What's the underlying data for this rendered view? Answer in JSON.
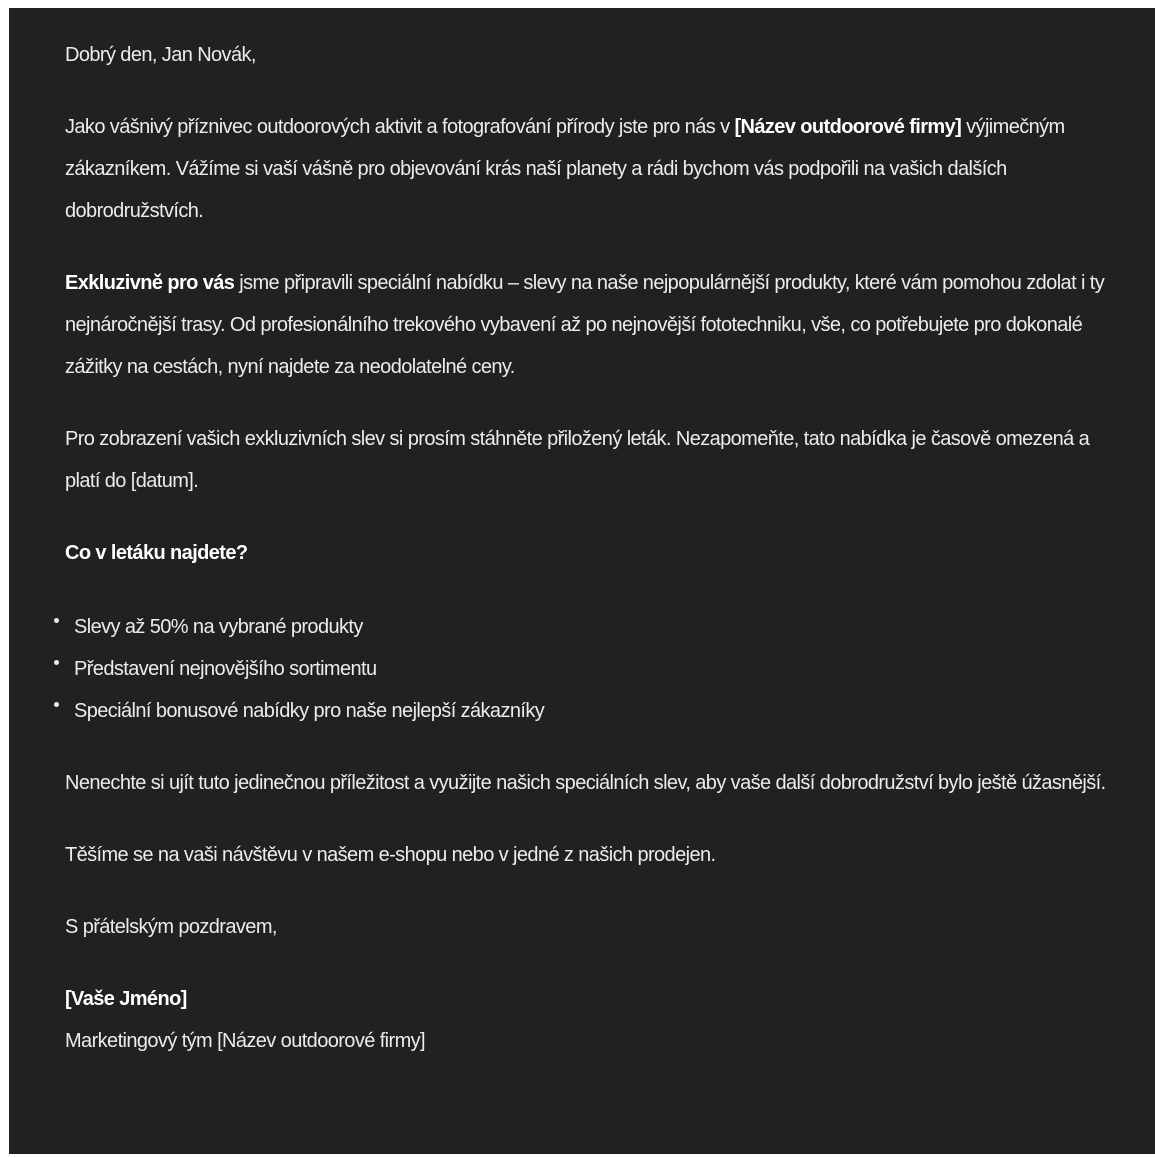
{
  "email": {
    "greeting": "Dobrý den, Jan Novák,",
    "intro": {
      "before": "Jako vášnivý příznivec outdoorových aktivit a fotografování přírody jste pro nás v ",
      "company": "[Název outdoorové firmy]",
      "after": " výjimečným zákazníkem. Vážíme si vaší vášně pro objevování krás naší planety a rádi bychom vás podpořili na vašich dalších dobrodružstvích."
    },
    "offer": {
      "lead": "Exkluzivně pro vás",
      "text": " jsme připravili speciální nabídku – slevy na naše nejpopulárnější produkty, které vám pomohou zdolat i ty nejnáročnější trasy. Od profesionálního trekového vybavení až po nejnovější fototechniku, vše, co potřebujete pro dokonalé zážitky na cestách, nyní najdete za neodolatelné ceny."
    },
    "download": "Pro zobrazení vašich exkluzivních slev si prosím stáhněte přiložený leták. Nezapomeňte, tato nabídka je časově omezená a platí do [datum].",
    "list_heading": "Co v letáku najdete?",
    "list_items": [
      "Slevy až 50% na vybrané produkty",
      "Představení nejnovějšího sortimentu",
      "Speciální bonusové nabídky pro naše nejlepší zákazníky"
    ],
    "cta": "Nenechte si ujít tuto jedinečnou příležitost a využijte našich speciálních slev, aby vaše další dobrodružství bylo ještě úžasnější.",
    "closing_line": "Těšíme se na vaši návštěvu v našem e-shopu nebo v jedné z našich prodejen.",
    "sign_off": "S přátelským pozdravem,",
    "signature_name": "[Vaše Jméno]",
    "signature_team": "Marketingový tým [Název outdoorové firmy]"
  },
  "colors": {
    "background": "#212121",
    "text": "#ececec"
  }
}
